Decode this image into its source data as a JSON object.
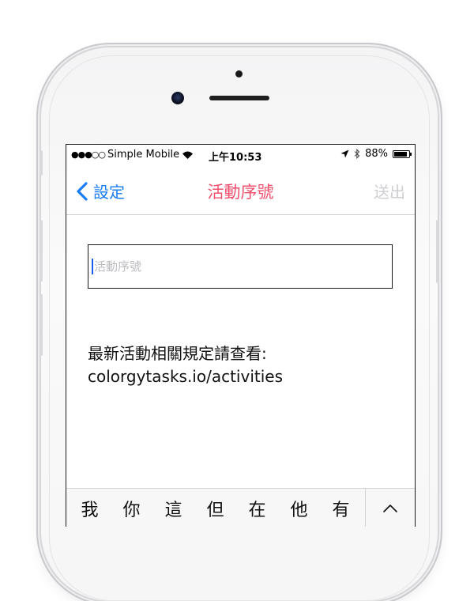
{
  "status_bar": {
    "carrier": "Simple Mobile",
    "time": "上午10:53",
    "battery_percent": "88%",
    "battery_level": 0.88
  },
  "nav": {
    "back_label": "設定",
    "title": "活動序號",
    "send_label": "送出"
  },
  "form": {
    "serial_placeholder": "活動序號",
    "serial_value": ""
  },
  "notice": {
    "line1": "最新活動相關規定請查看:",
    "line2": "colorgytasks.io/activities"
  },
  "keyboard": {
    "candidates": [
      "我",
      "你",
      "這",
      "但",
      "在",
      "他",
      "有"
    ]
  },
  "colors": {
    "accent_blue": "#1a7cf5",
    "title_pink": "#f0506e",
    "disabled_gray": "#cfcfd3"
  }
}
